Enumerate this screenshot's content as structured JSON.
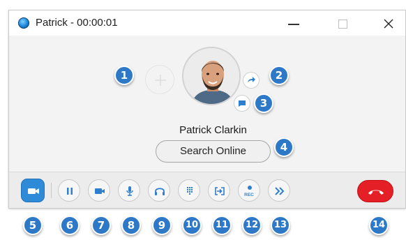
{
  "window": {
    "title": "Patrick - 00:00:01"
  },
  "contact": {
    "name": "Patrick Clarkin",
    "search_label": "Search Online"
  },
  "toolbar": {
    "rec_label": "REC"
  },
  "callouts": [
    "1",
    "2",
    "3",
    "4",
    "5",
    "6",
    "7",
    "8",
    "9",
    "10",
    "11",
    "12",
    "13",
    "14"
  ],
  "colors": {
    "accent": "#2d79c7",
    "video_active": "#2d8bd8",
    "end_call": "#e51f26",
    "icon_blue": "#2f7fd0"
  },
  "icons": {
    "add_participant": "plus-icon",
    "transfer": "arrow-right-icon",
    "chat": "chat-bubble-icon",
    "video_toggle": "video-camera-icon",
    "hold": "pause-icon",
    "video": "video-camera-icon",
    "mute": "microphone-icon",
    "audio_device": "headset-icon",
    "keypad": "dialpad-icon",
    "screen_share": "screen-share-icon",
    "record": "record-icon",
    "transfer_call": "double-chevron-right-icon",
    "hang_up": "phone-hangup-icon"
  }
}
